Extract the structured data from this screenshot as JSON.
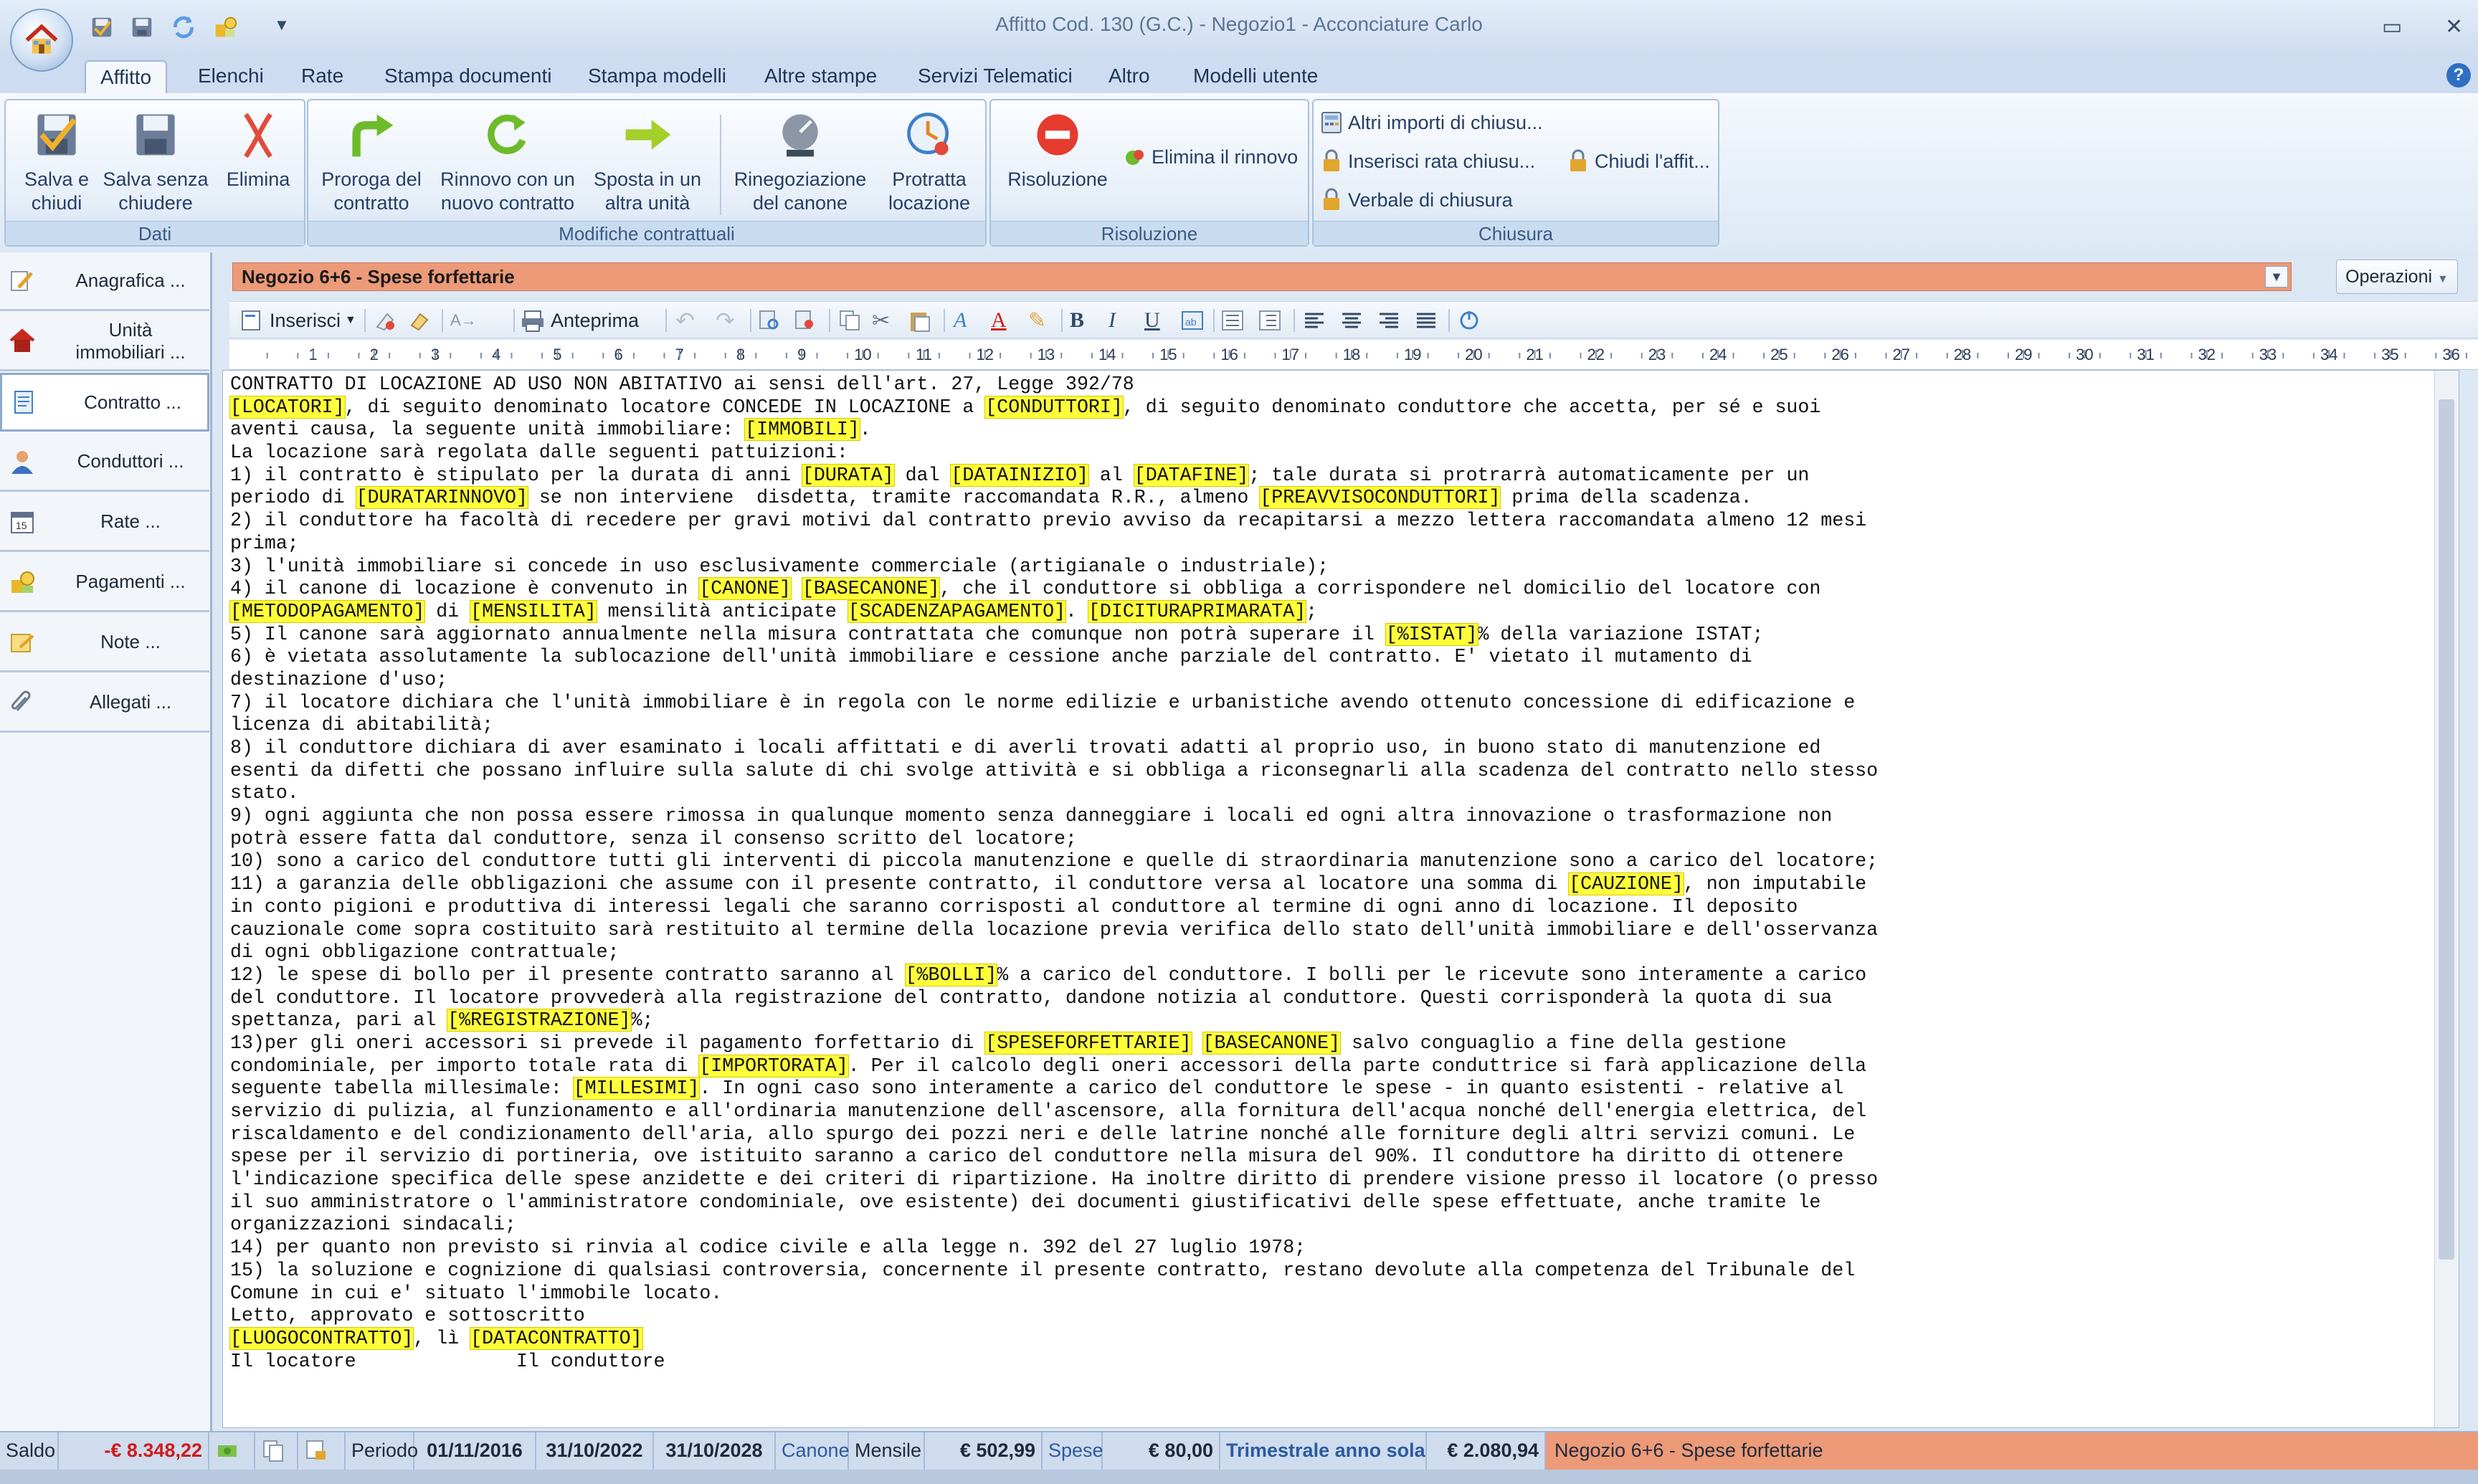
{
  "window": {
    "title": "Affitto Cod. 130 (G.C.) - Negozio1 - Acconciature Carlo",
    "minimize": "▭",
    "close": "✕"
  },
  "tabs": [
    "Affitto",
    "Elenchi",
    "Rate",
    "Stampa documenti",
    "Stampa modelli",
    "Altre stampe",
    "Servizi Telematici",
    "Altro",
    "Modelli utente"
  ],
  "help": "?",
  "ribbon": {
    "dati": {
      "caption": "Dati",
      "salva_chiudi": [
        "Salva e",
        "chiudi"
      ],
      "salva_senza": [
        "Salva senza",
        "chiudere"
      ],
      "elimina": [
        "Elimina"
      ]
    },
    "modifiche": {
      "caption": "Modifiche contrattuali",
      "proroga": [
        "Proroga del",
        "contratto"
      ],
      "rinnovo": [
        "Rinnovo con un",
        "nuovo contratto"
      ],
      "sposta": [
        "Sposta in un",
        "altra unità"
      ],
      "rinegoziazione": [
        "Rinegoziazione",
        "del canone"
      ],
      "protratta": [
        "Protratta",
        "locazione"
      ]
    },
    "risoluzione": {
      "caption": "Risoluzione",
      "risoluzione": [
        "Risoluzione"
      ],
      "elimina_rinnovo": "Elimina il rinnovo"
    },
    "chiusura": {
      "caption": "Chiusura",
      "altri_importi": "Altri importi di chiusu...",
      "inserisci_rata": "Inserisci rata chiusu...",
      "chiudi_affitto": "Chiudi l'affit...",
      "verbale": "Verbale di chiusura"
    }
  },
  "sidebar": [
    {
      "label": "Anagrafica ...",
      "icon": "pencil-icon"
    },
    {
      "label": "Unità immobiliari ...",
      "icon": "house-icon"
    },
    {
      "label": "Contratto ...",
      "icon": "document-icon",
      "selected": true
    },
    {
      "label": "Conduttori ...",
      "icon": "person-icon"
    },
    {
      "label": "Rate ...",
      "icon": "calendar-icon"
    },
    {
      "label": "Pagamenti ...",
      "icon": "coins-icon"
    },
    {
      "label": "Note ...",
      "icon": "note-icon"
    },
    {
      "label": "Allegati ...",
      "icon": "paperclip-icon"
    }
  ],
  "template_select": "Negozio 6+6 - Spese forfettarie",
  "operazioni": "Operazioni",
  "editor_toolbar": {
    "inserisci": "Inserisci",
    "anteprima": "Anteprima"
  },
  "ruler_labels": [
    "1",
    "2",
    "3",
    "4",
    "5",
    "6",
    "7",
    "8",
    "9",
    "10",
    "11",
    "12",
    "13",
    "14",
    "15",
    "16",
    "17",
    "18",
    "19",
    "20",
    "21",
    "22",
    "23",
    "24",
    "25",
    "26",
    "27",
    "28",
    "29",
    "30",
    "31",
    "32",
    "33",
    "34",
    "35",
    "36"
  ],
  "document_lines": [
    "CONTRATTO DI LOCAZIONE AD USO NON ABITATIVO ai sensi dell'art. 27, Legge 392/78",
    "[LOCATORI], di seguito denominato locatore CONCEDE IN LOCAZIONE a [CONDUTTORI], di seguito denominato conduttore che accetta, per sé e suoi",
    "aventi causa, la seguente unità immobiliare: [IMMOBILI].",
    "La locazione sarà regolata dalle seguenti pattuizioni:",
    "1) il contratto è stipulato per la durata di anni [DURATA] dal [DATAINIZIO] al [DATAFINE]; tale durata si protrarrà automaticamente per un",
    "periodo di [DURATARINNOVO] se non interviene  disdetta, tramite raccomandata R.R., almeno [PREAVVISOCONDUTTORI] prima della scadenza.",
    "2) il conduttore ha facoltà di recedere per gravi motivi dal contratto previo avviso da recapitarsi a mezzo lettera raccomandata almeno 12 mesi",
    "prima;",
    "3) l'unità immobiliare si concede in uso esclusivamente commerciale (artigianale o industriale);",
    "4) il canone di locazione è convenuto in [CANONE] [BASECANONE], che il conduttore si obbliga a corrispondere nel domicilio del locatore con",
    "[METODOPAGAMENTO] di [MENSILITA] mensilità anticipate [SCADENZAPAGAMENTO]. [DICITURAPRIMARATA];",
    "5) Il canone sarà aggiornato annualmente nella misura contrattata che comunque non potrà superare il [%ISTAT]% della variazione ISTAT;",
    "6) è vietata assolutamente la sublocazione dell'unità immobiliare e cessione anche parziale del contratto. E' vietato il mutamento di",
    "destinazione d'uso;",
    "7) il locatore dichiara che l'unità immobiliare è in regola con le norme edilizie e urbanistiche avendo ottenuto concessione di edificazione e",
    "licenza di abitabilità;",
    "8) il conduttore dichiara di aver esaminato i locali affittati e di averli trovati adatti al proprio uso, in buono stato di manutenzione ed",
    "esenti da difetti che possano influire sulla salute di chi svolge attività e si obbliga a riconsegnarli alla scadenza del contratto nello stesso",
    "stato.",
    "9) ogni aggiunta che non possa essere rimossa in qualunque momento senza danneggiare i locali ed ogni altra innovazione o trasformazione non",
    "potrà essere fatta dal conduttore, senza il consenso scritto del locatore;",
    "10) sono a carico del conduttore tutti gli interventi di piccola manutenzione e quelle di straordinaria manutenzione sono a carico del locatore;",
    "11) a garanzia delle obbligazioni che assume con il presente contratto, il conduttore versa al locatore una somma di [CAUZIONE], non imputabile",
    "in conto pigioni e produttiva di interessi legali che saranno corrisposti al conduttore al termine di ogni anno di locazione. Il deposito",
    "cauzionale come sopra costituito sarà restituito al termine della locazione previa verifica dello stato dell'unità immobiliare e dell'osservanza",
    "di ogni obbligazione contrattuale;",
    "12) le spese di bollo per il presente contratto saranno al [%BOLLI]% a carico del conduttore. I bolli per le ricevute sono interamente a carico",
    "del conduttore. Il locatore provvederà alla registrazione del contratto, dandone notizia al conduttore. Questi corrisponderà la quota di sua",
    "spettanza, pari al [%REGISTRAZIONE]%;",
    "13)per gli oneri accessori si prevede il pagamento forfettario di [SPESEFORFETTARIE] [BASECANONE] salvo conguaglio a fine della gestione",
    "condominiale, per importo totale rata di [IMPORTORATA]. Per il calcolo degli oneri accessori della parte conduttrice si farà applicazione della",
    "seguente tabella millesimale: [MILLESIMI]. In ogni caso sono interamente a carico del conduttore le spese - in quanto esistenti - relative al",
    "servizio di pulizia, al funzionamento e all'ordinaria manutenzione dell'ascensore, alla fornitura dell'acqua nonché dell'energia elettrica, del",
    "riscaldamento e del condizionamento dell'aria, allo spurgo dei pozzi neri e delle latrine nonché alle forniture degli altri servizi comuni. Le",
    "spese per il servizio di portineria, ove istituito saranno a carico del conduttore nella misura del 90%. Il conduttore ha diritto di ottenere",
    "l'indicazione specifica delle spese anzidette e dei criteri di ripartizione. Ha inoltre diritto di prendere visione presso il locatore (o presso",
    "il suo amministratore o l'amministratore condominiale, ove esistente) dei documenti giustificativi delle spese effettuate, anche tramite le",
    "organizzazioni sindacali;",
    "14) per quanto non previsto si rinvia al codice civile e alla legge n. 392 del 27 luglio 1978;",
    "15) la soluzione e cognizione di qualsiasi controversia, concernente il presente contratto, restano devolute alla competenza del Tribunale del",
    "Comune in cui e' situato l'immobile locato.",
    "Letto, approvato e sottoscritto",
    "[LUOGOCONTRATTO], lì [DATACONTRATTO]",
    "Il locatore              Il conduttore"
  ],
  "status": {
    "saldo_label": "Saldo",
    "saldo_value": "-€ 8.348,22",
    "periodo_label": "Periodo",
    "inizio": "01/11/2016",
    "fine": "31/10/2022",
    "fine2": "31/10/2028",
    "canone_label": "Canone",
    "mensile": "Mensile",
    "canone_value": "€ 502,99",
    "spese_label": "Spese",
    "spese_value": "€ 80,00",
    "trimestrale": "Trimestrale anno sola",
    "totale": "€ 2.080,94",
    "modello": "Negozio 6+6 - Spese forfettarie"
  },
  "colors": {
    "accent": "#ec9a78",
    "placeholder": "#ffff3a",
    "negative": "#d01a1a",
    "ribbon_bg": "#dde9f6"
  }
}
